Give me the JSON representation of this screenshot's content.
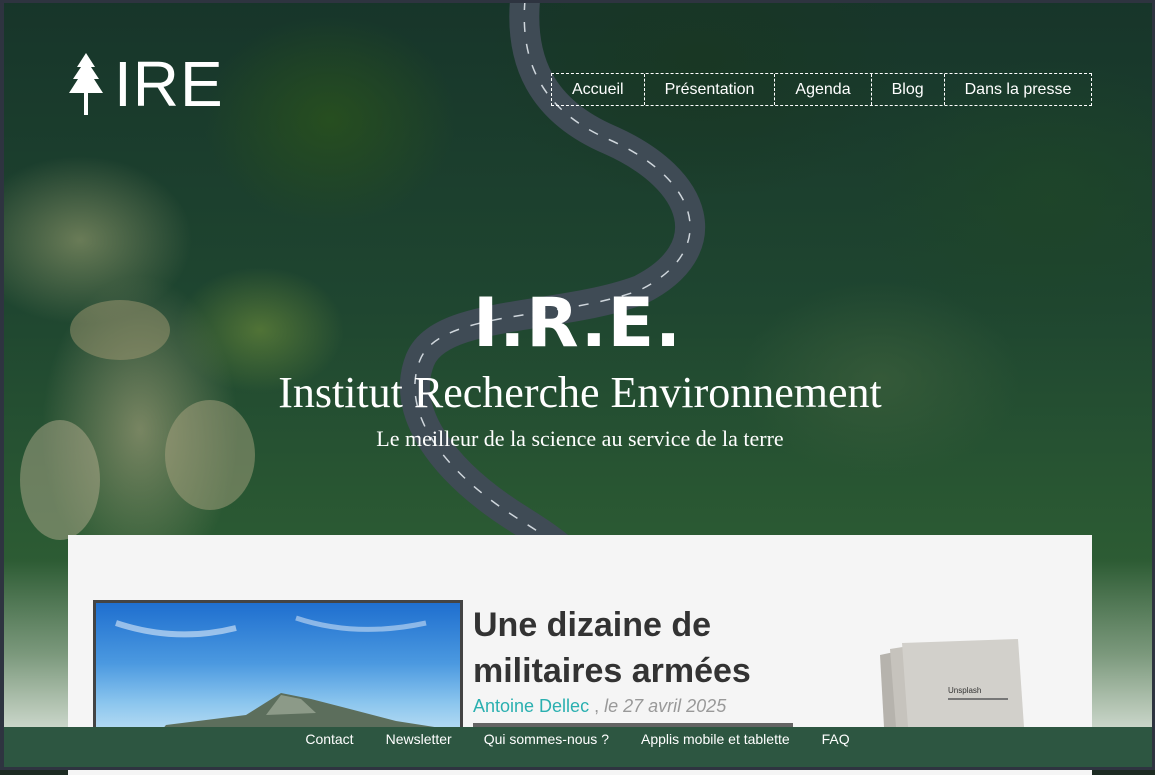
{
  "logo": {
    "text": "IRE",
    "icon": "tree-icon"
  },
  "nav": {
    "items": [
      "Accueil",
      "Présentation",
      "Agenda",
      "Blog",
      "Dans la presse"
    ]
  },
  "hero": {
    "title": "I.R.E.",
    "subtitle": "Institut Recherche Environnement",
    "tagline": "Le meilleur de la science au service de la terre"
  },
  "article": {
    "title": "Une dizaine de militaires armées",
    "author": "Antoine Dellec",
    "separator": ",",
    "date": "le 27 avril 2025",
    "book_label": "Unsplash"
  },
  "footer": {
    "links": [
      "Contact",
      "Newsletter",
      "Qui sommes-nous ?",
      "Applis mobile et tablette",
      "FAQ"
    ]
  },
  "colors": {
    "footer_bg": "#2d5641",
    "author": "#2ab0b0",
    "content_bg": "#f5f5f5"
  }
}
